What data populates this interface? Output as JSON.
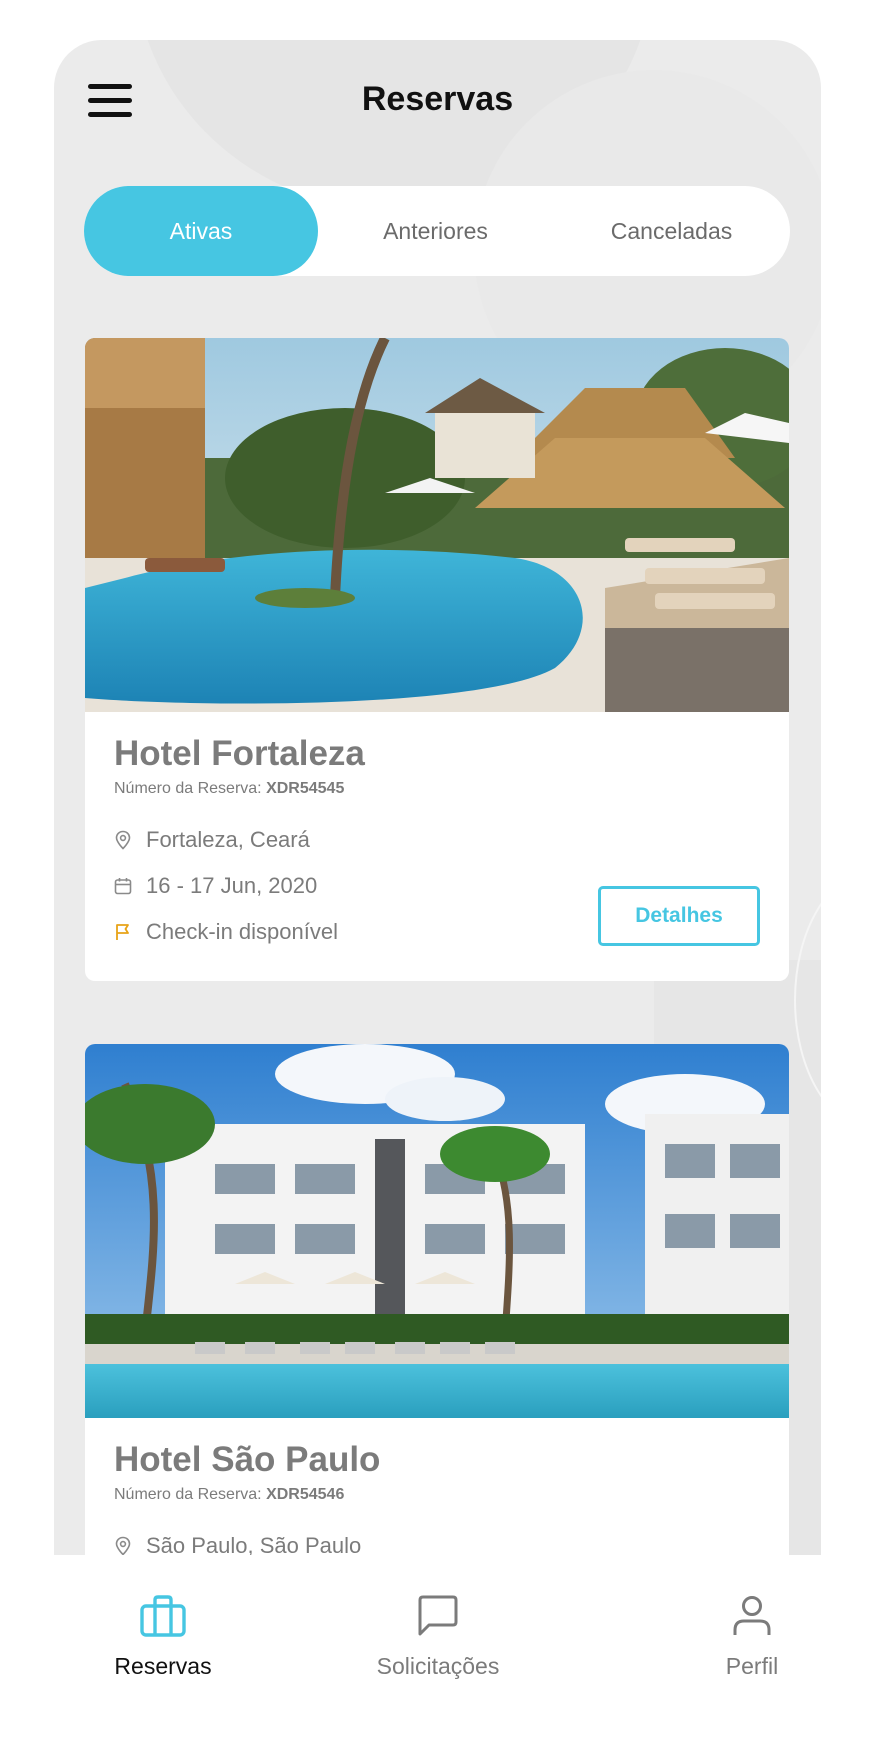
{
  "header": {
    "title": "Reservas"
  },
  "tabs": [
    {
      "label": "Ativas",
      "active": true
    },
    {
      "label": "Anteriores",
      "active": false
    },
    {
      "label": "Canceladas",
      "active": false
    }
  ],
  "bookings": [
    {
      "hotel": "Hotel Fortaleza",
      "reservation_label": "Número da Reserva:",
      "reservation_number": "XDR54545",
      "location": "Fortaleza, Ceará",
      "dates": "16 - 17 Jun, 2020",
      "status": "Check-in disponível",
      "details_label": "Detalhes"
    },
    {
      "hotel": "Hotel São Paulo",
      "reservation_label": "Número da Reserva:",
      "reservation_number": "XDR54546",
      "location": "São Paulo, São Paulo"
    }
  ],
  "nav": [
    {
      "label": "Reservas",
      "icon": "briefcase-icon",
      "active": true
    },
    {
      "label": "Solicitações",
      "icon": "chat-icon",
      "active": false
    },
    {
      "label": "Perfil",
      "icon": "user-icon",
      "active": false
    }
  ],
  "colors": {
    "accent": "#46c6e2",
    "flag": "#e8a317",
    "background": "#ebebeb"
  }
}
